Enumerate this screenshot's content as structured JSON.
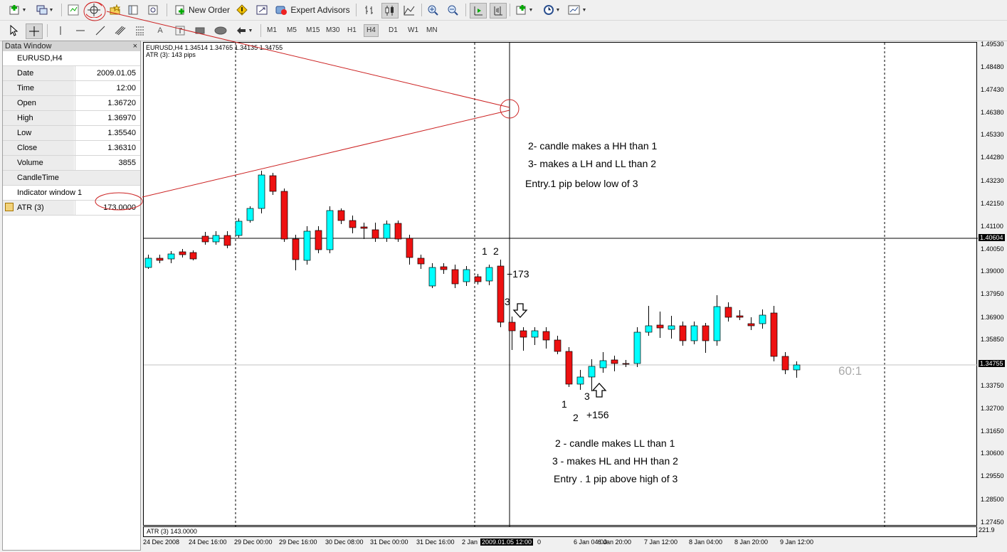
{
  "toolbar": {
    "new_order": "New Order",
    "expert_advisors": "Expert Advisors",
    "timeframes": [
      "M1",
      "M5",
      "M15",
      "M30",
      "H1",
      "H4",
      "D1",
      "W1",
      "MN"
    ],
    "active_timeframe": "H4"
  },
  "data_window": {
    "title": "Data Window",
    "close": "×",
    "symbol": "EURUSD,H4",
    "rows": [
      {
        "label": "Date",
        "value": "2009.01.05"
      },
      {
        "label": "Time",
        "value": "12:00"
      },
      {
        "label": "Open",
        "value": "1.36720"
      },
      {
        "label": "High",
        "value": "1.36970"
      },
      {
        "label": "Low",
        "value": "1.35540"
      },
      {
        "label": "Close",
        "value": "1.36310"
      },
      {
        "label": "Volume",
        "value": "3855"
      }
    ],
    "candletime": "CandleTime",
    "indicator_window": "Indicator window 1",
    "atr_label": "ATR (3)",
    "atr_value": "173.0000"
  },
  "chart": {
    "ohlc_header": "EURUSD,H4  1.34514 1.34765 1.34135 1.34755",
    "atr_header": "ATR (3): 143 pips",
    "indicator_label": "ATR (3) 143.0000",
    "indicator_scale": "221.9",
    "crosshair_price": "1.40604",
    "bid_price": "1.34755",
    "y_ticks": [
      "1.49530",
      "1.48480",
      "1.47430",
      "1.46380",
      "1.45330",
      "1.44280",
      "1.43230",
      "1.42150",
      "1.41100",
      "1.40050",
      "1.39000",
      "1.37950",
      "1.36900",
      "1.35850",
      "1.34755",
      "1.33750",
      "1.32700",
      "1.31650",
      "1.30600",
      "1.29550",
      "1.28500",
      "1.27450"
    ],
    "x_ticks": [
      "24 Dec 2008",
      "24 Dec 16:00",
      "29 Dec 00:00",
      "29 Dec 16:00",
      "30 Dec 08:00",
      "31 Dec 00:00",
      "31 Dec 16:00",
      "2 Jan",
      "6 Jan 04:00",
      "6 Jan 20:00",
      "7 Jan 12:00",
      "8 Jan 04:00",
      "8 Jan 20:00",
      "9 Jan 12:00"
    ],
    "x_cursor_label": "2009.01.05 12:00",
    "x_partial": "0",
    "ratio": "60:1",
    "bullish_color": "#00ffff",
    "bearish_color": "#ee1111"
  },
  "annotations": {
    "top_note_1": "2- candle makes a HH than 1",
    "top_note_2": "3- makes a LH and LL than 2",
    "top_note_3": "Entry.1 pip below low of 3",
    "bottom_note_1": "2 - candle makes LL than 1",
    "bottom_note_2": "3 - makes HL and HH than 2",
    "bottom_note_3": "Entry . 1 pip above high of 3",
    "label_1a": "1",
    "label_2a": "2",
    "label_3a": "3",
    "pips_a": "+173",
    "label_1b": "1",
    "label_2b": "2",
    "label_3b": "3",
    "pips_b": "+156"
  }
}
